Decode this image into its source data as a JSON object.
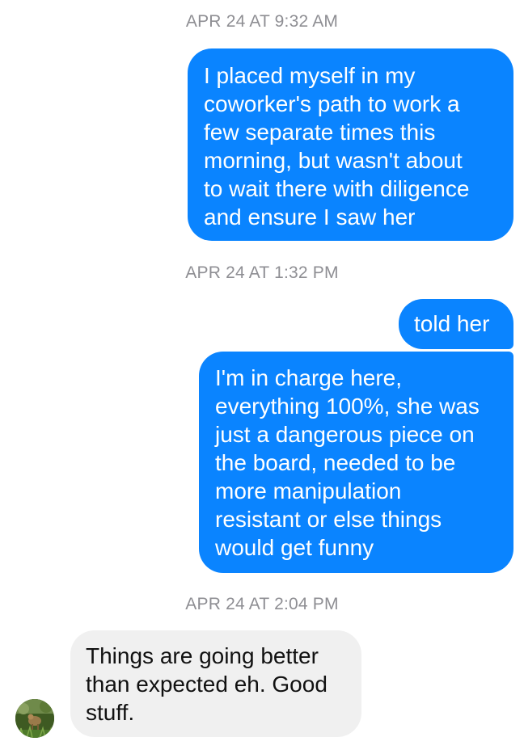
{
  "conversation": {
    "timestamps": [
      "APR 24 AT 9:32 AM",
      "APR 24 AT 1:32 PM",
      "APR 24 AT 2:04 PM"
    ],
    "messages": [
      {
        "sender": "me",
        "text": "I placed myself in my\ncoworker's path to work a\nfew separate times this\nmorning, but wasn't about\nto wait there with diligence\nand ensure I saw her"
      },
      {
        "sender": "me",
        "text": "told her"
      },
      {
        "sender": "me",
        "text": "I'm in charge here,\neverything 100%, she was\njust a dangerous piece on\nthe board, needed to be\nmore manipulation\nresistant or else things\nwould get funny"
      },
      {
        "sender": "contact",
        "text": "Things are going better\nthan expected eh. Good\nstuff."
      }
    ]
  },
  "colors": {
    "sent_bubble": "#0a84ff",
    "received_bubble": "#f0f0f0",
    "timestamp_text": "#8e8e93"
  },
  "icons": {
    "contact_avatar": "avatar-icon"
  }
}
